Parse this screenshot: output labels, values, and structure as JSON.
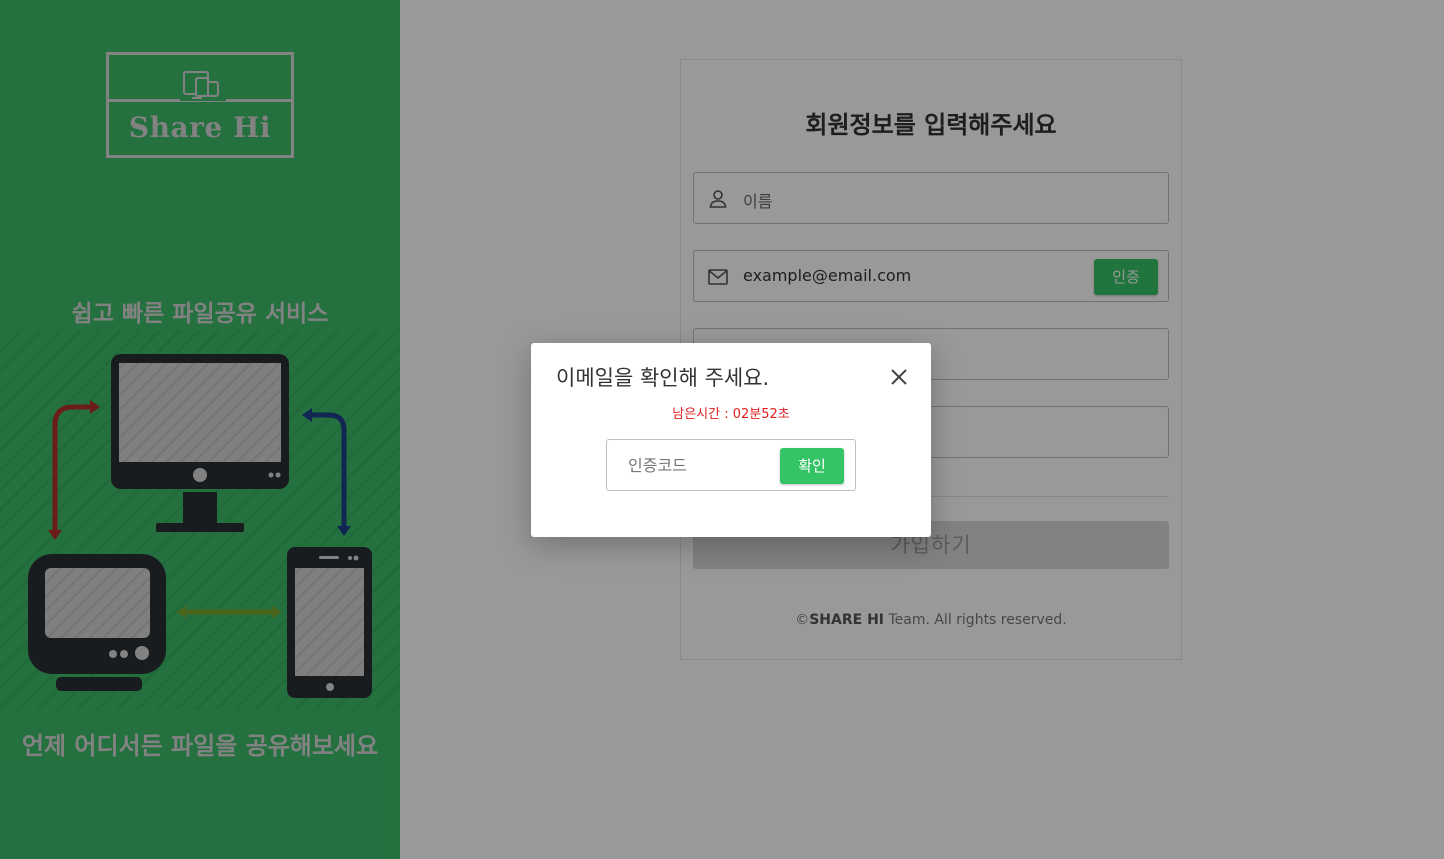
{
  "brand": {
    "logo_text": "Share Hi",
    "tagline_top": "쉽고 빠른 파일공유 서비스",
    "tagline_bottom": "언제 어디서든 파일을 공유해보세요"
  },
  "signup": {
    "title": "회원정보를 입력해주세요",
    "name_placeholder": "이름",
    "email_value": "example@email.com",
    "verify_label": "인증",
    "submit_label": "가입하기",
    "footer_brand": "SHARE HI",
    "footer_prefix": "©",
    "footer_suffix": " Team. All rights reserved."
  },
  "modal": {
    "title": "이메일을 확인해 주세요.",
    "timer": "남은시간 : 02분52초",
    "code_placeholder": "인증코드",
    "confirm_label": "확인"
  },
  "colors": {
    "brand_green": "#3dbb6a",
    "button_green": "#34c466",
    "timer_red": "#e02020"
  }
}
